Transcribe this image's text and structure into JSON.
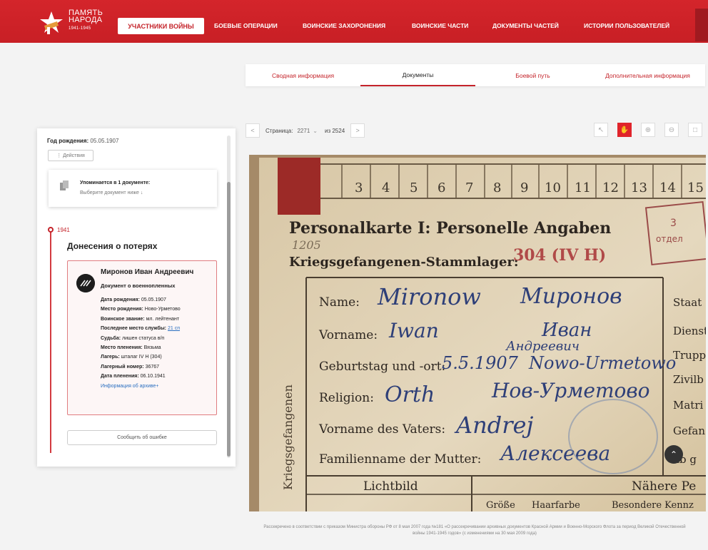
{
  "header": {
    "logo_line1": "ПАМЯТЬ",
    "logo_line2": "НАРОДА",
    "logo_years": "1941-1945",
    "nav": [
      "УЧАСТНИКИ ВОЙНЫ",
      "БОЕВЫЕ ОПЕРАЦИИ",
      "ВОИНСКИЕ ЗАХОРОНЕНИЯ",
      "ВОИНСКИЕ ЧАСТИ",
      "ДОКУМЕНТЫ ЧАСТЕЙ",
      "ИСТОРИИ ПОЛЬЗОВАТЕЛЕЙ"
    ]
  },
  "tabs": [
    "Сводная информация",
    "Документы",
    "Боевой путь",
    "Дополнительная информация"
  ],
  "sidebar": {
    "birth_label": "Год рождения:",
    "birth_value": "05.05.1907",
    "actions": "⋮ Действия",
    "mention_title": "Упоминается в 1 документе:",
    "mention_sub": "Выберите документ ниже ↓",
    "year": "1941",
    "section_title": "Донесения о потерях",
    "person": {
      "name": "Миронов Иван Андреевич",
      "doc_type": "Документ о военнопленных",
      "fields": [
        {
          "label": "Дата рождения:",
          "value": "05.05.1907"
        },
        {
          "label": "Место рождения:",
          "value": "Ново-Урметово"
        },
        {
          "label": "Воинское звание:",
          "value": "мл. лейтенант"
        },
        {
          "label": "Последнее место службы:",
          "value": "21 сп"
        },
        {
          "label": "Судьба:",
          "value": "лишен статуса в/п"
        },
        {
          "label": "Место пленения:",
          "value": "Вязьма"
        },
        {
          "label": "Лагерь:",
          "value": "шталаг IV H (304)"
        },
        {
          "label": "Лагерный номер:",
          "value": "36767"
        },
        {
          "label": "Дата пленения:",
          "value": "06.10.1941"
        }
      ],
      "archive_link": "Информация об архиве+"
    },
    "report_button": "Сообщить об ошибке"
  },
  "pager": {
    "prev": "<",
    "label": "Страница:",
    "page": "2271",
    "total": "из 2524",
    "next": ">"
  },
  "document": {
    "columns": [
      "3",
      "4",
      "5",
      "6",
      "7",
      "8",
      "9",
      "10",
      "11",
      "12",
      "13",
      "14",
      "15"
    ],
    "heading": "Personalkarte I: Personelle Angaben",
    "stammlager": "Kriegsgefangenen-Stammlager:",
    "stammlager_num": "304 (IV H)",
    "handwritten_num": "1205",
    "stamp_line1": "3",
    "stamp_line2": "отдел",
    "fields": [
      "Name:",
      "Vorname:",
      "Geburtstag und -ort:",
      "Religion:",
      "Vorname des Vaters:",
      "Familienname der Mutter:"
    ],
    "handwriting": [
      "Mironow",
      "Миронов",
      "Iwan",
      "Иван",
      "Андреевич",
      "5.5.1907",
      "Nowo-Urmetowo",
      "Нов-Урметово",
      "Orth",
      "Andrej",
      "Алексеева"
    ],
    "side_text": "Kriegsgefangenen",
    "bottom_label": "Lichtbild",
    "bottom_right": "Nähere Pe",
    "sub_headers": [
      "Größe",
      "Haarfarbe",
      "Besondere Kennz"
    ],
    "right_labels": [
      "Staat",
      "Dienst",
      "Trupp",
      "Zivilb",
      "Matri",
      "Gefan",
      "ab g"
    ]
  },
  "footer": "Рассекречено в соответствии с приказом Министра обороны РФ от 8 мая 2007 года №181 «О рассекречивании архивных документов Красной Армии и Военно-Морского Флота за период Великой Отечественной войны 1941-1945 годов» (с изменениями на 30 мая 2009 года)"
}
